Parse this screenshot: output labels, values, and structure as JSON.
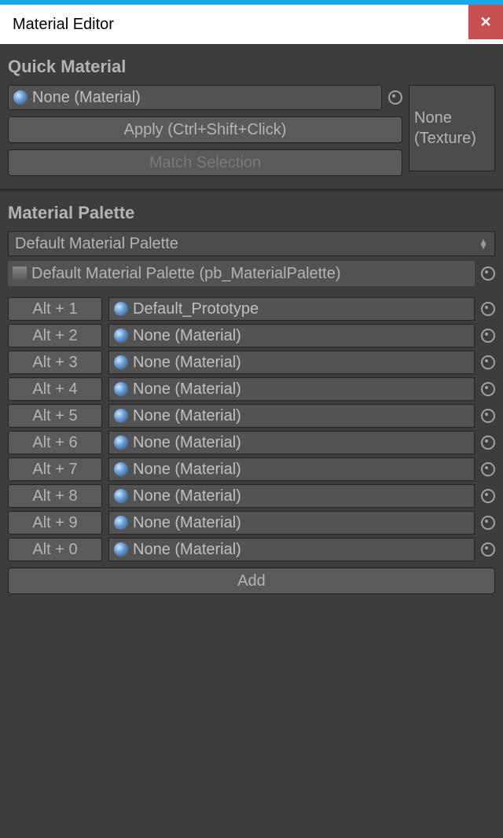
{
  "window": {
    "title": "Material Editor"
  },
  "quick": {
    "section_title": "Quick Material",
    "material_value": "None (Material)",
    "apply_label": "Apply (Ctrl+Shift+Click)",
    "match_label": "Match Selection",
    "texture_label": "None (Texture)"
  },
  "palette": {
    "section_title": "Material Palette",
    "dropdown_value": "Default Material Palette",
    "asset_value": "Default Material Palette (pb_MaterialPalette)",
    "items": [
      {
        "shortcut": "Alt + 1",
        "value": "Default_Prototype"
      },
      {
        "shortcut": "Alt + 2",
        "value": "None (Material)"
      },
      {
        "shortcut": "Alt + 3",
        "value": "None (Material)"
      },
      {
        "shortcut": "Alt + 4",
        "value": "None (Material)"
      },
      {
        "shortcut": "Alt + 5",
        "value": "None (Material)"
      },
      {
        "shortcut": "Alt + 6",
        "value": "None (Material)"
      },
      {
        "shortcut": "Alt + 7",
        "value": "None (Material)"
      },
      {
        "shortcut": "Alt + 8",
        "value": "None (Material)"
      },
      {
        "shortcut": "Alt + 9",
        "value": "None (Material)"
      },
      {
        "shortcut": "Alt + 0",
        "value": "None (Material)"
      }
    ],
    "add_label": "Add"
  }
}
